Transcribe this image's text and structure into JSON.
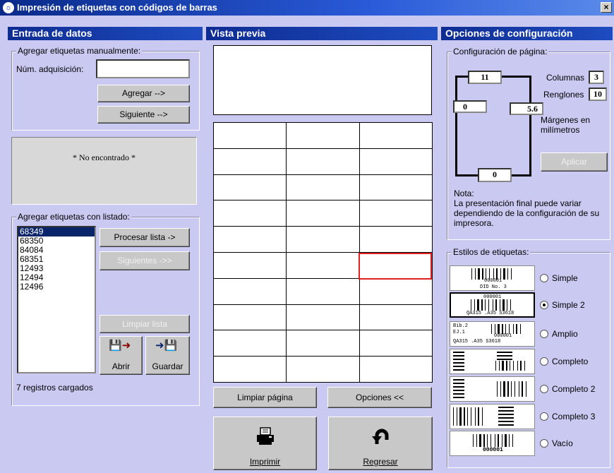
{
  "window": {
    "title": "Impresión de etiquetas con códigos de barras",
    "close": "×"
  },
  "left": {
    "header": "Entrada de datos",
    "manual": {
      "group_label": "Agregar etiquetas manualmente:",
      "acq_label": "Núm. adquisición:",
      "acq_value": "",
      "add_button": "Agregar -->",
      "next_button": "Siguiente -->"
    },
    "status_text": "* No encontrado *",
    "list": {
      "group_label": "Agregar etiquetas con listado:",
      "items": [
        "68349",
        "68350",
        "84084",
        "68351",
        "12493",
        "12494",
        "12496"
      ],
      "selected_index": 0,
      "process_button": "Procesar lista ->",
      "next_button": "Siguientes ->>",
      "clear_button": "Limpiar lista",
      "open_button": "Abrir",
      "save_button": "Guardar",
      "records_text": "7 registros cargados"
    }
  },
  "middle": {
    "header": "Vista previa",
    "clear_page_button": "Limpiar página",
    "options_button": "Opciones <<",
    "print_button": "Imprimir",
    "back_button": "Regresar"
  },
  "right": {
    "header": "Opciones de configuración",
    "page": {
      "group_label": "Configuración de página:",
      "top_margin": "11",
      "left_margin": "0",
      "right_margin": "5.6",
      "bottom_margin": "0",
      "columns_label": "Columnas",
      "columns_value": "3",
      "rows_label": "Renglones",
      "rows_value": "10",
      "units_text": "Márgenes en milímetros",
      "apply_button": "Aplicar",
      "note_title": "Nota:",
      "note_text": "La presentación final puede variar dependiendo de la configuración de su impresora."
    },
    "styles": {
      "group_label": "Estilos de etiquetas:",
      "options": [
        {
          "label": "Simple",
          "selected": false
        },
        {
          "label": "Simple 2",
          "selected": true
        },
        {
          "label": "Amplio",
          "selected": false
        },
        {
          "label": "Completo",
          "selected": false
        },
        {
          "label": "Completo 2",
          "selected": false
        },
        {
          "label": "Completo 3",
          "selected": false
        },
        {
          "label": "Vacío",
          "selected": false
        }
      ],
      "preview_texts": {
        "simple_number": "000001",
        "simple_caption": "DID No. 3",
        "simple2_number": "000001",
        "simple2_caption": "QA315 .A35 S3618",
        "amplio_top": "Bib.2",
        "amplio_ej": "EJ.1",
        "amplio_number": "000001",
        "amplio_caption": "QA315 .A35 S3618",
        "vacio_number": "000001"
      }
    }
  },
  "colors": {
    "selection": "#0a246a",
    "highlight_cell": "#e02020",
    "panel_bg": "#c9c9f2"
  }
}
